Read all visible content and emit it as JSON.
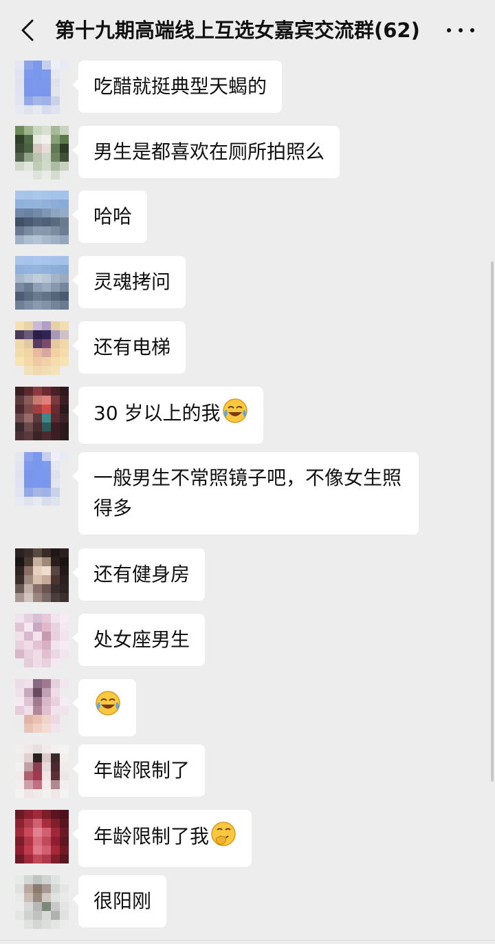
{
  "header": {
    "title": "第十九期高端线上互选女嘉宾交流群(62)",
    "back_icon": "chevron-left-icon",
    "more_icon": "more-horizontal-icon"
  },
  "messages": [
    {
      "text": "吃醋就挺典型天蝎的",
      "emoji": ""
    },
    {
      "text": "男生是都喜欢在厕所拍照么",
      "emoji": ""
    },
    {
      "text": "哈哈",
      "emoji": ""
    },
    {
      "text": "灵魂拷问",
      "emoji": ""
    },
    {
      "text": "还有电梯",
      "emoji": ""
    },
    {
      "text": "30 岁以上的我",
      "emoji": "laugh-cry-emoji"
    },
    {
      "text": "一般男生不常照镜子吧，不像女生照得多",
      "emoji": ""
    },
    {
      "text": "还有健身房",
      "emoji": ""
    },
    {
      "text": "处女座男生",
      "emoji": ""
    },
    {
      "text": "",
      "emoji": "laugh-cry-emoji"
    },
    {
      "text": "年龄限制了",
      "emoji": ""
    },
    {
      "text": "年龄限制了我",
      "emoji": "thinking-emoji"
    },
    {
      "text": "很阳刚",
      "emoji": ""
    }
  ],
  "colors": {
    "background": "#ededed",
    "bubble": "#ffffff",
    "text": "#111111"
  }
}
